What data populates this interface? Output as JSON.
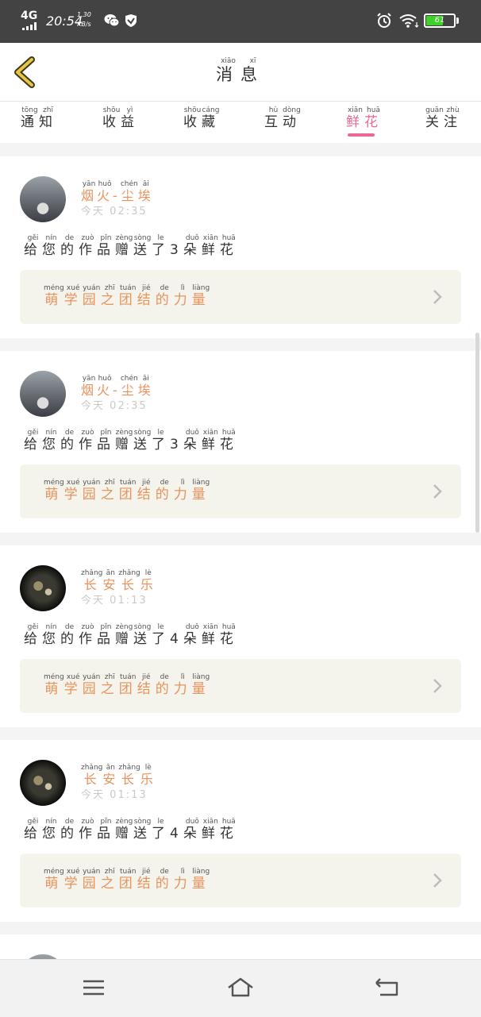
{
  "status_bar": {
    "network": "4G",
    "time": "20:54",
    "speed_value": "1.30",
    "speed_unit": "KB/s",
    "battery": "61",
    "battery_color": "#3ed12a"
  },
  "header": {
    "title_chars": [
      "消",
      "息"
    ],
    "title_pinyin": [
      "xiāo",
      "xī"
    ]
  },
  "tabs": [
    {
      "chars": [
        "通",
        "知"
      ],
      "pinyin": [
        "tōng",
        "zhī"
      ]
    },
    {
      "chars": [
        "收",
        "益"
      ],
      "pinyin": [
        "shōu",
        "yì"
      ]
    },
    {
      "chars": [
        "收",
        "藏"
      ],
      "pinyin": [
        "shōu",
        "cáng"
      ]
    },
    {
      "chars": [
        "互",
        "动"
      ],
      "pinyin": [
        "hù",
        "dòng"
      ]
    },
    {
      "chars": [
        "鲜",
        "花"
      ],
      "pinyin": [
        "xiān",
        "huā"
      ]
    },
    {
      "chars": [
        "关",
        "注"
      ],
      "pinyin": [
        "guān",
        "zhù"
      ]
    }
  ],
  "active_tab_index": 4,
  "accent_color": "#e8689a",
  "messages": [
    {
      "user_chars": [
        "烟",
        "火",
        "-",
        "尘",
        "埃"
      ],
      "user_pinyin": [
        "yān",
        "huǒ",
        "",
        "chén",
        "āi"
      ],
      "day_chars": [
        "今",
        "天"
      ],
      "time": "02:35",
      "msg_chars": [
        "给",
        "您",
        "的",
        "作",
        "品",
        "赠",
        "送",
        "了",
        "3",
        "朵",
        "鲜",
        "花"
      ],
      "msg_pinyin": [
        "gěi",
        "nín",
        "de",
        "zuò",
        "pǐn",
        "zèng",
        "sòng",
        "le",
        "",
        "duǒ",
        "xiān",
        "huā"
      ],
      "work_chars": [
        "萌",
        "学",
        "园",
        "之",
        "团",
        "结",
        "的",
        "力",
        "量"
      ],
      "work_pinyin": [
        "méng",
        "xué",
        "yuán",
        "zhī",
        "tuán",
        "jié",
        "de",
        "lì",
        "liàng"
      ]
    },
    {
      "user_chars": [
        "烟",
        "火",
        "-",
        "尘",
        "埃"
      ],
      "user_pinyin": [
        "yān",
        "huǒ",
        "",
        "chén",
        "āi"
      ],
      "day_chars": [
        "今",
        "天"
      ],
      "time": "02:35",
      "msg_chars": [
        "给",
        "您",
        "的",
        "作",
        "品",
        "赠",
        "送",
        "了",
        "3",
        "朵",
        "鲜",
        "花"
      ],
      "msg_pinyin": [
        "gěi",
        "nín",
        "de",
        "zuò",
        "pǐn",
        "zèng",
        "sòng",
        "le",
        "",
        "duǒ",
        "xiān",
        "huā"
      ],
      "work_chars": [
        "萌",
        "学",
        "园",
        "之",
        "团",
        "结",
        "的",
        "力",
        "量"
      ],
      "work_pinyin": [
        "méng",
        "xué",
        "yuán",
        "zhī",
        "tuán",
        "jié",
        "de",
        "lì",
        "liàng"
      ]
    },
    {
      "user_chars": [
        "长",
        "安",
        "长",
        "乐"
      ],
      "user_pinyin": [
        "zhǎng",
        "ān",
        "zhǎng",
        "lè"
      ],
      "day_chars": [
        "今",
        "天"
      ],
      "time": "01:13",
      "msg_chars": [
        "给",
        "您",
        "的",
        "作",
        "品",
        "赠",
        "送",
        "了",
        "4",
        "朵",
        "鲜",
        "花"
      ],
      "msg_pinyin": [
        "gěi",
        "nín",
        "de",
        "zuò",
        "pǐn",
        "zèng",
        "sòng",
        "le",
        "",
        "duǒ",
        "xiān",
        "huā"
      ],
      "work_chars": [
        "萌",
        "学",
        "园",
        "之",
        "团",
        "结",
        "的",
        "力",
        "量"
      ],
      "work_pinyin": [
        "méng",
        "xué",
        "yuán",
        "zhī",
        "tuán",
        "jié",
        "de",
        "lì",
        "liàng"
      ]
    },
    {
      "user_chars": [
        "长",
        "安",
        "长",
        "乐"
      ],
      "user_pinyin": [
        "zhǎng",
        "ān",
        "zhǎng",
        "lè"
      ],
      "day_chars": [
        "今",
        "天"
      ],
      "time": "01:13",
      "msg_chars": [
        "给",
        "您",
        "的",
        "作",
        "品",
        "赠",
        "送",
        "了",
        "4",
        "朵",
        "鲜",
        "花"
      ],
      "msg_pinyin": [
        "gěi",
        "nín",
        "de",
        "zuò",
        "pǐn",
        "zèng",
        "sòng",
        "le",
        "",
        "duǒ",
        "xiān",
        "huā"
      ],
      "work_chars": [
        "萌",
        "学",
        "园",
        "之",
        "团",
        "结",
        "的",
        "力",
        "量"
      ],
      "work_pinyin": [
        "méng",
        "xué",
        "yuán",
        "zhī",
        "tuán",
        "jié",
        "de",
        "lì",
        "liàng"
      ]
    }
  ],
  "icons": {
    "back": "back-chevron-icon",
    "chevron": "chevron-right-icon",
    "nav_menu": "menu-icon",
    "nav_home": "home-icon",
    "nav_back": "return-icon"
  }
}
